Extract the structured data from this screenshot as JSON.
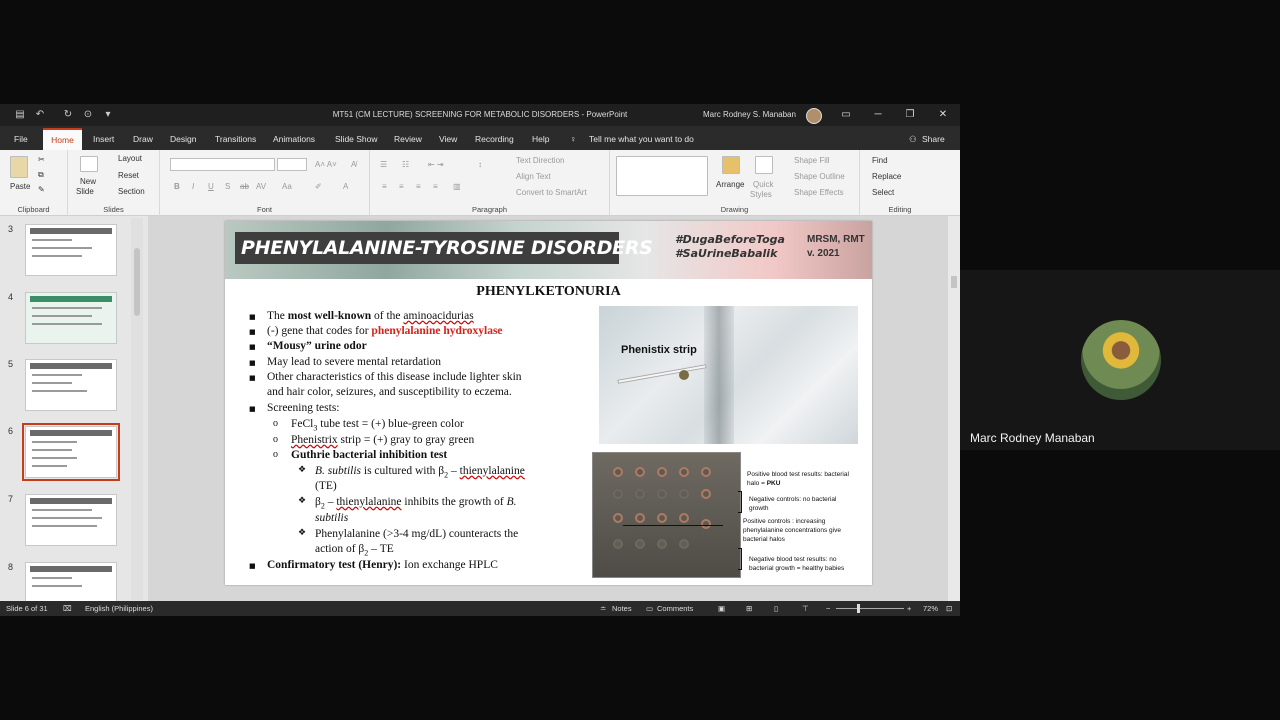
{
  "window": {
    "title": "MT51 (CM LECTURE) SCREENING FOR METABOLIC DISORDERS  -  PowerPoint",
    "user": "Marc Rodney S. Manaban"
  },
  "menu": {
    "tabs": [
      "File",
      "Home",
      "Insert",
      "Draw",
      "Design",
      "Transitions",
      "Animations",
      "Slide Show",
      "Review",
      "View",
      "Recording",
      "Help"
    ],
    "active_tab": "Home",
    "tell_me": "Tell me what you want to do",
    "share": "Share"
  },
  "ribbon": {
    "clipboard": {
      "paste": "Paste",
      "label": "Clipboard"
    },
    "slides": {
      "new_slide": "New",
      "new_slide2": "Slide",
      "layout": "Layout",
      "reset": "Reset",
      "section": "Section",
      "label": "Slides"
    },
    "font": {
      "label": "Font"
    },
    "paragraph": {
      "text_direction": "Text Direction",
      "align_text": "Align Text",
      "convert_smartart": "Convert to SmartArt",
      "label": "Paragraph"
    },
    "drawing": {
      "arrange": "Arrange",
      "quick_styles": "Quick",
      "quick_styles2": "Styles",
      "shape_fill": "Shape Fill",
      "shape_outline": "Shape Outline",
      "shape_effects": "Shape Effects",
      "label": "Drawing"
    },
    "editing": {
      "find": "Find",
      "replace": "Replace",
      "select": "Select",
      "label": "Editing"
    }
  },
  "thumbnails": [
    {
      "num": "3"
    },
    {
      "num": "4"
    },
    {
      "num": "5"
    },
    {
      "num": "6"
    },
    {
      "num": "7"
    },
    {
      "num": "8"
    }
  ],
  "slide": {
    "banner_title": "PHENYLALANINE-TYROSINE DISORDERS",
    "tag1": "#DugaBeforeToga",
    "tag2": "#SaUrineBabalik",
    "mrsm": "MRSM, RMT",
    "version": "v. 2021",
    "heading": "PHENYLKETONURIA",
    "b1_pre": "The ",
    "b1_bold": "most well-known",
    "b1_mid": " of the ",
    "b1_ul": "aminoacidurias",
    "b2_pre": "(-) gene that codes for ",
    "b2_red": "phenylalanine hydroxylase",
    "b3": "“Mousy” urine odor",
    "b4": "May lead to severe mental retardation",
    "b5a": "Other characteristics of this disease include lighter skin",
    "b5b": "and hair color, seizures, and susceptibility to eczema.",
    "b6": "Screening tests:",
    "s1_a": "FeCl",
    "s1_sub": "3",
    "s1_b": " tube test = (+) blue-green color",
    "s2_ul": "Phenistrix",
    "s2_b": " strip = (+) gray to gray green",
    "s3": "Guthrie bacterial inhibition test",
    "t1_a": "B. subtilis",
    "t1_b": " is cultured with β",
    "t1_sub": "2",
    "t1_c": " – ",
    "t1_ul": "thienylalanine",
    "t1_d": "(TE)",
    "t2_a": "β",
    "t2_sub": "2",
    "t2_b": " – ",
    "t2_ul": "thienylalanine",
    "t2_c": " inhibits the growth of ",
    "t2_d": "B.",
    "t2_e": "subtilis",
    "t3_a": "Phenylalanine (>3-4 mg/dL) counteracts the",
    "t3_b": "action of β",
    "t3_sub": "2",
    "t3_c": " – TE",
    "conf_bold": "Confirmatory test (Henry):",
    "conf_rest": " Ion exchange HPLC",
    "photo_label": "Phenistix strip",
    "cap1a": "Positive blood test results: bacterial",
    "cap1b_pre": "halo = ",
    "cap1b_bold": "PKU",
    "cap2a": "Negative controls:  no bacterial",
    "cap2b": "growth",
    "cap3a": "Positive controls :  increasing",
    "cap3b": "phenylalanine concentrations give",
    "cap3c": "bacterial halos",
    "cap4a": "Negative blood test results:  no",
    "cap4b": "bacterial growth = healthy babies"
  },
  "status": {
    "slide_of": "Slide 6 of 31",
    "language": "English (Philippines)",
    "notes": "Notes",
    "comments": "Comments",
    "zoom": "72%"
  },
  "participant": {
    "name": "Marc Rodney Manaban"
  }
}
